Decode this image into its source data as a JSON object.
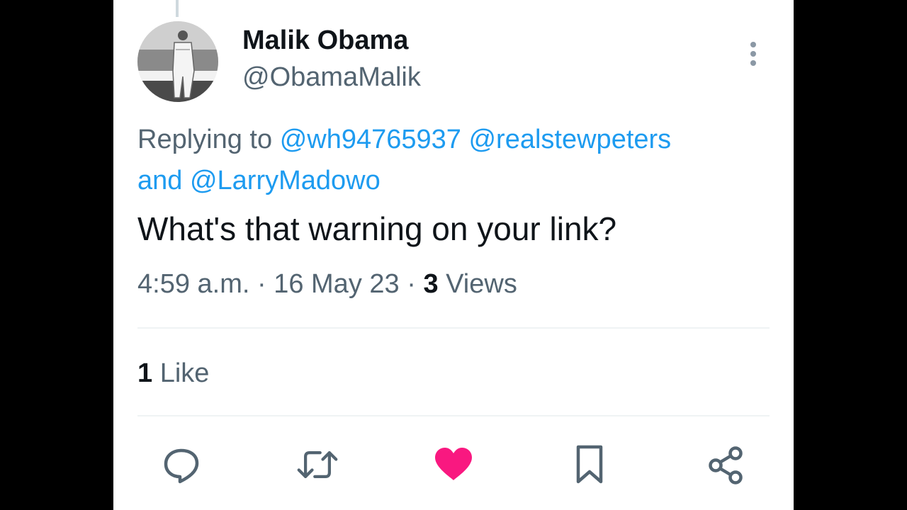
{
  "tweet": {
    "author_name": "Malik Obama",
    "author_handle": "@ObamaMalik",
    "replying_prefix": "Replying to",
    "mention_1": "@wh94765937",
    "mention_2": "@realstewpeters",
    "mention_joiner": "and",
    "mention_3": "@LarryMadowo",
    "text": "What's that warning on your link?",
    "time": "4:59 a.m.",
    "separator": "·",
    "date": "16 May 23",
    "views_count": "3",
    "views_label": "Views",
    "likes_count": "1",
    "likes_label": "Like"
  },
  "actions": [
    {
      "name": "reply",
      "icon": "speech-bubble-icon"
    },
    {
      "name": "retweet",
      "icon": "retweet-icon"
    },
    {
      "name": "like",
      "icon": "heart-icon",
      "active": true
    },
    {
      "name": "bookmark",
      "icon": "bookmark-icon"
    },
    {
      "name": "share",
      "icon": "share-icon"
    }
  ],
  "colors": {
    "text_primary": "#0f1419",
    "text_secondary": "#536471",
    "link": "#1d9bf0",
    "like_active": "#f91880",
    "divider": "#eff3f4",
    "background": "#ffffff",
    "letterbox": "#000000"
  }
}
